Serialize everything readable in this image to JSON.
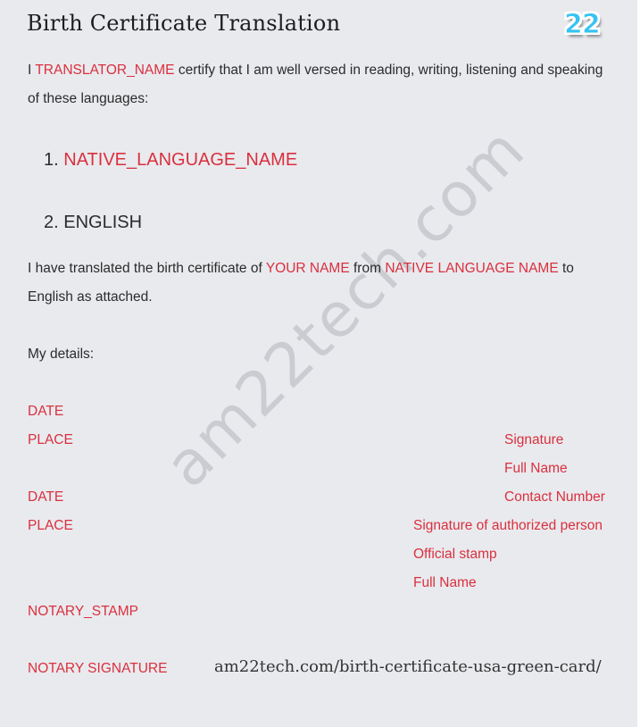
{
  "document": {
    "title": "Birth Certificate Translation",
    "logo_text": "22",
    "certify": {
      "prefix": "I ",
      "translator_name": "TRANSLATOR_NAME",
      "line1_rest": " certify that I am well versed in reading, writing, listening and speaking",
      "line2": "of these languages:"
    },
    "languages": [
      {
        "number": "1. ",
        "name": "NATIVE_LANGUAGE_NAME"
      },
      {
        "number": "2. ",
        "name": "ENGLISH"
      }
    ],
    "translated": {
      "part1": "I have translated the birth certificate of ",
      "your_name": "YOUR NAME",
      "part2": " from ",
      "native_language": "NATIVE LANGUAGE NAME",
      "part3": " to",
      "line2": "English as attached."
    },
    "my_details_label": "My details:",
    "left_fields": [
      "DATE",
      "PLACE",
      "DATE",
      "PLACE",
      "NOTARY_STAMP",
      "NOTARY SIGNATURE"
    ],
    "translator_fields": [
      "Signature",
      "Full Name",
      "Contact Number"
    ],
    "authority_fields": [
      "Signature of authorized person",
      "Official stamp",
      "Full Name"
    ],
    "source_url": "am22tech.com/birth-certificate-usa-green-card/",
    "watermark": "am22tech.com"
  },
  "colors": {
    "background": "#e9eaee",
    "placeholder_red": "#d9303e",
    "text": "#2b2b2b",
    "logo_blue": "#36c3f2"
  }
}
